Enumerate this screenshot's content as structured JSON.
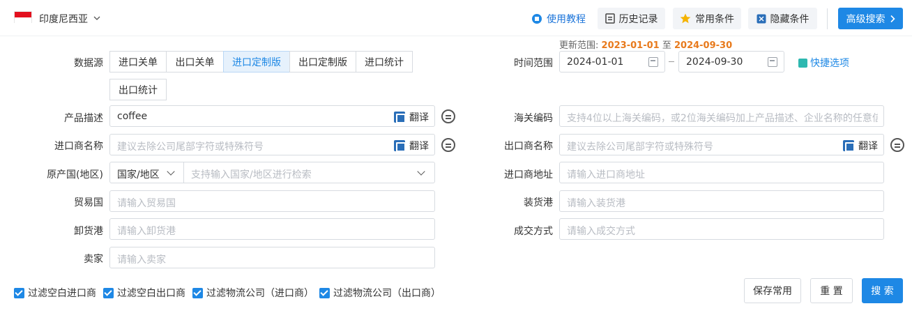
{
  "header": {
    "country": "印度尼西亚",
    "buttons": {
      "tutorial": "使用教程",
      "history": "历史记录",
      "favorites": "常用条件",
      "hide": "隐藏条件",
      "advanced": "高级搜索"
    }
  },
  "update_range": {
    "prefix": "更新范围:",
    "start": "2023-01-01",
    "sep": "至",
    "end": "2024-09-30"
  },
  "form": {
    "datasource_label": "数据源",
    "datasource_options": [
      "进口关单",
      "出口关单",
      "进口定制版",
      "出口定制版",
      "进口统计",
      "出口统计"
    ],
    "datasource_selected": "进口定制版",
    "time_label": "时间范围",
    "time_start": "2024-01-01",
    "time_end": "2024-09-30",
    "quick_label": "快捷选项",
    "product_label": "产品描述",
    "product_value": "coffee",
    "hs_label": "海关编码",
    "hs_placeholder": "支持4位以上海关编码，或2位海关编码加上产品描述、企业名称的任意信...",
    "importer_label": "进口商名称",
    "importer_placeholder": "建议去除公司尾部字符或特殊符号",
    "exporter_label": "出口商名称",
    "exporter_placeholder": "建议去除公司尾部字符或特殊符号",
    "translate_label": "翻译",
    "origin_label": "原产国(地区)",
    "origin_type": "国家/地区",
    "origin_placeholder": "支持输入国家/地区进行检索",
    "importer_addr_label": "进口商地址",
    "importer_addr_placeholder": "请输入进口商地址",
    "trade_label": "贸易国",
    "trade_placeholder": "请输入贸易国",
    "loading_label": "装货港",
    "loading_placeholder": "请输入装货港",
    "unloading_label": "卸货港",
    "unloading_placeholder": "请输入卸货港",
    "deal_label": "成交方式",
    "deal_placeholder": "请输入成交方式",
    "seller_label": "卖家",
    "seller_placeholder": "请输入卖家"
  },
  "filters": {
    "f1": "过滤空白进口商",
    "f2": "过滤空白出口商",
    "f3": "过滤物流公司（进口商）",
    "f4": "过滤物流公司（出口商）"
  },
  "actions": {
    "save": "保存常用",
    "reset": "重 置",
    "search": "搜 索"
  },
  "colors": {
    "primary": "#1e88e5",
    "accent_orange": "#e87a1c",
    "flag_red": "#e3101e"
  }
}
